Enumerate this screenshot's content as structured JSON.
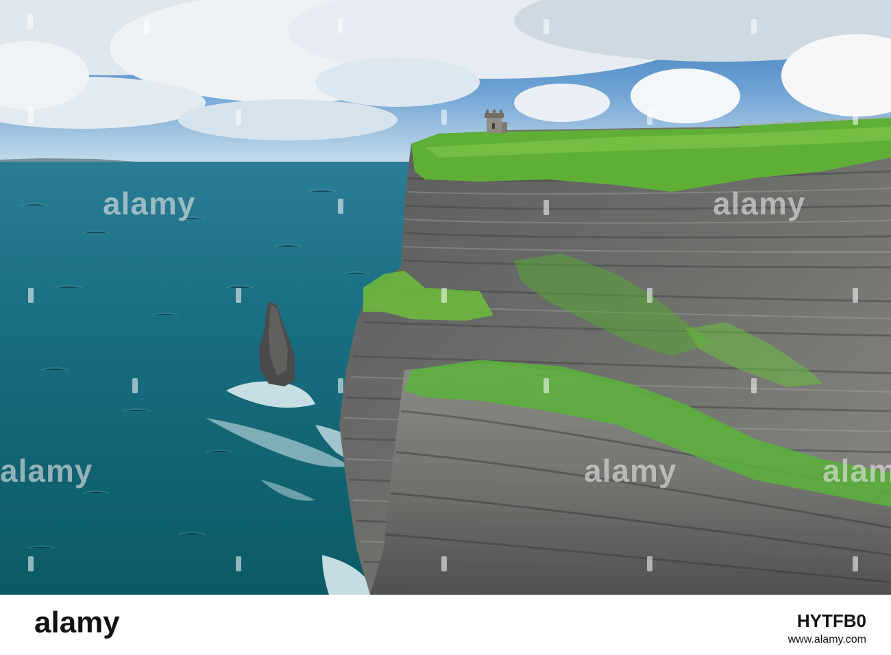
{
  "photo": {
    "subject": "sea-cliffs-with-tower-and-sea-stack",
    "colors": {
      "sky_top": "#3f7fc2",
      "sky_bottom": "#bfd8ea",
      "cloud": "#f2f5f8",
      "sea_near": "#0f6572",
      "sea_far": "#2a7f9a",
      "grass": "#63b83a",
      "rock_dark": "#3b3d42",
      "rock_light": "#9a9c98",
      "foam": "#e8f4f6"
    }
  },
  "watermark": {
    "text": "alamy"
  },
  "footer": {
    "brand": "alamy",
    "image_id": "HYTFB0",
    "url": "www.alamy.com"
  }
}
